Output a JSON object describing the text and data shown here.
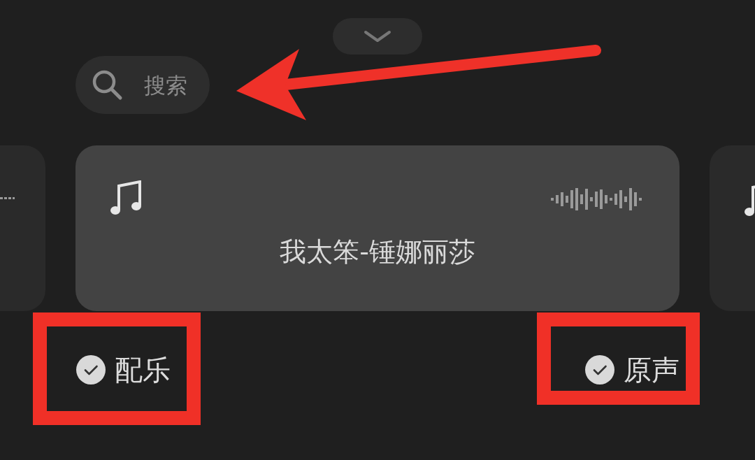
{
  "search": {
    "placeholder": "搜索"
  },
  "card": {
    "title": "我太笨-锤娜丽莎"
  },
  "options": [
    {
      "label": "配乐",
      "checked": true
    },
    {
      "label": "原声",
      "checked": true
    }
  ]
}
